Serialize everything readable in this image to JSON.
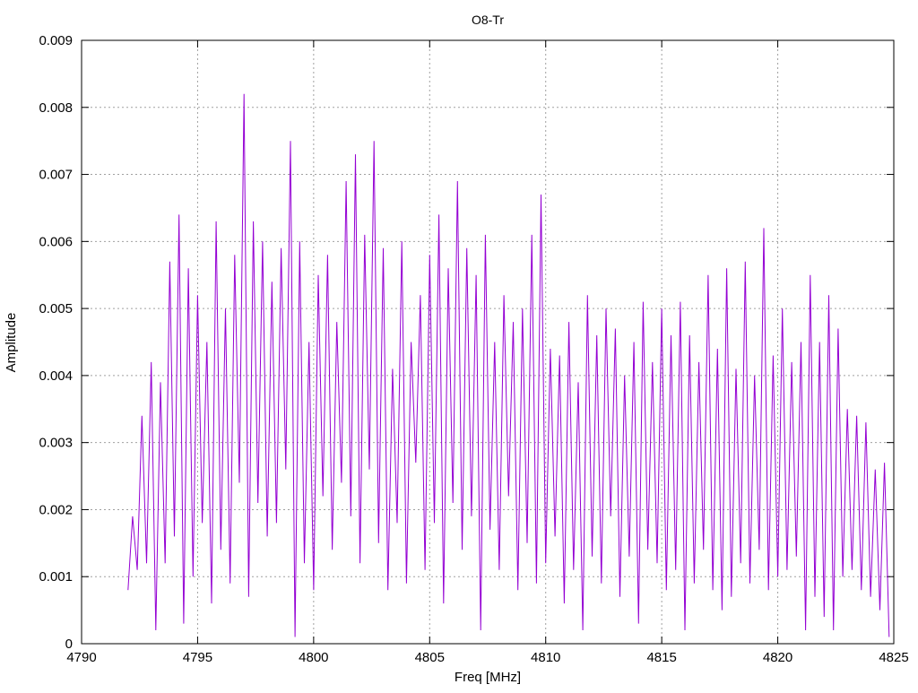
{
  "chart_data": {
    "type": "line",
    "title": "O8-Tr",
    "xlabel": "Freq [MHz]",
    "ylabel": "Amplitude",
    "xlim": [
      4790,
      4825
    ],
    "ylim": [
      0,
      0.009
    ],
    "xticks": [
      "4790",
      "4795",
      "4800",
      "4805",
      "4810",
      "4815",
      "4820",
      "4825"
    ],
    "yticks": [
      "0",
      "0.001",
      "0.002",
      "0.003",
      "0.004",
      "0.005",
      "0.006",
      "0.007",
      "0.008",
      "0.009"
    ],
    "grid": true,
    "series": [
      {
        "name": "O8-Tr",
        "color": "#9400d3",
        "x_start": 4792.0,
        "x_step": 0.2,
        "y": [
          0.0008,
          0.0019,
          0.0011,
          0.0034,
          0.0012,
          0.0042,
          0.0002,
          0.0039,
          0.0012,
          0.0057,
          0.0016,
          0.0064,
          0.0003,
          0.0056,
          0.001,
          0.0052,
          0.0018,
          0.0045,
          0.0006,
          0.0063,
          0.0014,
          0.005,
          0.0009,
          0.0058,
          0.0024,
          0.0082,
          0.0007,
          0.0063,
          0.0021,
          0.006,
          0.0016,
          0.0054,
          0.0018,
          0.0059,
          0.0026,
          0.0075,
          0.0001,
          0.006,
          0.0012,
          0.0045,
          0.0008,
          0.0055,
          0.0022,
          0.0058,
          0.0014,
          0.0048,
          0.0024,
          0.0069,
          0.0019,
          0.0073,
          0.0012,
          0.0061,
          0.0026,
          0.0075,
          0.0015,
          0.0059,
          0.0008,
          0.0041,
          0.0018,
          0.006,
          0.0009,
          0.0045,
          0.0027,
          0.0052,
          0.0011,
          0.0058,
          0.0018,
          0.0064,
          0.0006,
          0.0056,
          0.0021,
          0.0069,
          0.0014,
          0.0059,
          0.0019,
          0.0055,
          0.0002,
          0.0061,
          0.0017,
          0.0045,
          0.0011,
          0.0052,
          0.0022,
          0.0048,
          0.0008,
          0.005,
          0.0015,
          0.0061,
          0.0009,
          0.0067,
          0.0012,
          0.0044,
          0.0016,
          0.0043,
          0.0006,
          0.0048,
          0.0011,
          0.0039,
          0.0002,
          0.0052,
          0.0013,
          0.0046,
          0.0009,
          0.005,
          0.0019,
          0.0047,
          0.0007,
          0.004,
          0.0013,
          0.0045,
          0.0003,
          0.0051,
          0.0014,
          0.0042,
          0.0012,
          0.005,
          0.0008,
          0.0046,
          0.0011,
          0.0051,
          0.0002,
          0.0046,
          0.0009,
          0.0042,
          0.0014,
          0.0055,
          0.0008,
          0.0044,
          0.0005,
          0.0056,
          0.0007,
          0.0041,
          0.0012,
          0.0057,
          0.0009,
          0.004,
          0.0014,
          0.0062,
          0.0008,
          0.0043,
          0.001,
          0.005,
          0.0011,
          0.0042,
          0.0013,
          0.0045,
          0.0002,
          0.0055,
          0.0007,
          0.0045,
          0.0004,
          0.0052,
          0.0002,
          0.0047,
          0.001,
          0.0035,
          0.0011,
          0.0034,
          0.0008,
          0.0033,
          0.0007,
          0.0026,
          0.0005,
          0.0027,
          0.0001
        ]
      }
    ]
  }
}
